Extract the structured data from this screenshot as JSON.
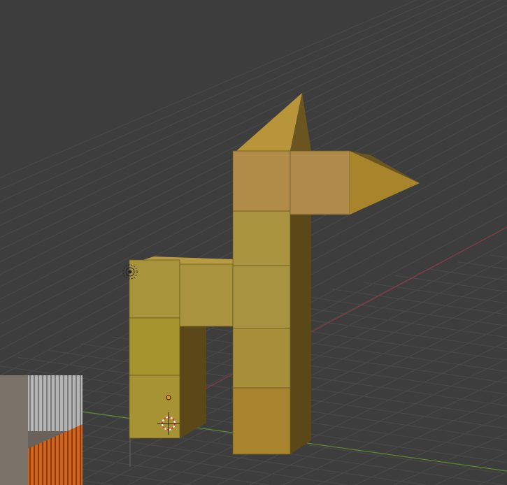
{
  "viewport": {
    "background": "#3d3d3d",
    "grid_color": "#4a4a4a",
    "x_axis_color": "#8a3a44",
    "y_axis_color": "#5e8a2e"
  },
  "model": {
    "front_color": "#a8923a",
    "side_color": "#5a4818",
    "top_color": "#b89a40"
  },
  "icons": [
    "light-icon",
    "3d-cursor-icon",
    "origin-point-icon"
  ],
  "reference_image": {
    "colors": [
      "#9a9a9a",
      "#d0661e"
    ]
  }
}
